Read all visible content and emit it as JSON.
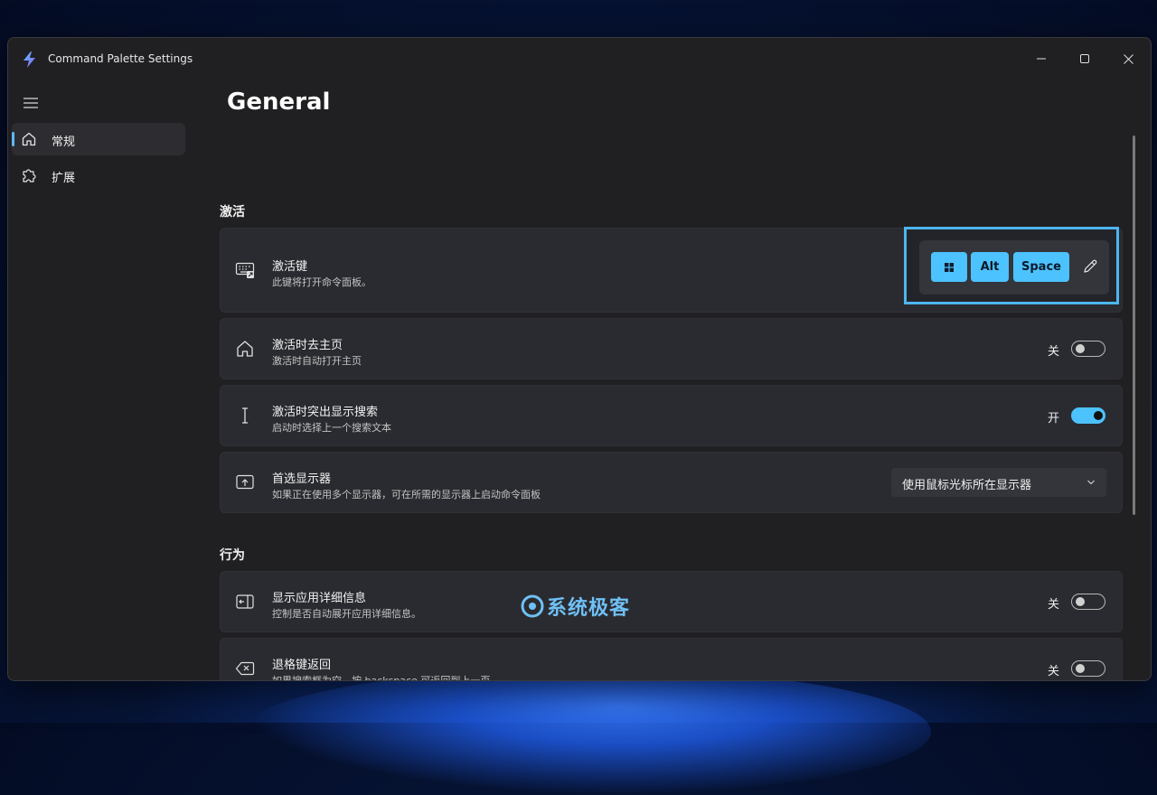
{
  "window": {
    "title": "Command Palette Settings",
    "accent": "#4cc2ff"
  },
  "sidebar": {
    "menu_icon": "hamburger-icon",
    "items": [
      {
        "label": "常规",
        "icon": "home-icon",
        "selected": true
      },
      {
        "label": "扩展",
        "icon": "puzzle-icon",
        "selected": false
      }
    ]
  },
  "page": {
    "title": "General",
    "sections": [
      {
        "header": "激活"
      },
      {
        "header": "行为"
      }
    ]
  },
  "settings": {
    "activation_key": {
      "title": "激活键",
      "desc": "此键将打开命令面板。",
      "keys": [
        "win-key-icon",
        "Alt",
        "Space"
      ],
      "edit_icon": "pencil-icon"
    },
    "go_home": {
      "title": "激活时去主页",
      "desc": "激活时自动打开主页",
      "state_label": "关",
      "on": false
    },
    "highlight_search": {
      "title": "激活时突出显示搜索",
      "desc": "启动时选择上一个搜索文本",
      "state_label": "开",
      "on": true
    },
    "preferred_monitor": {
      "title": "首选显示器",
      "desc": "如果正在使用多个显示器，可在所需的显示器上启动命令面板",
      "selected": "使用鼠标光标所在显示器"
    },
    "show_app_details": {
      "title": "显示应用详细信息",
      "desc": "控制是否自动展开应用详细信息。",
      "state_label": "关",
      "on": false
    },
    "backspace_back": {
      "title": "退格键返回",
      "desc": "如果搜索框为空，按 backspace 可返回到上一页",
      "state_label": "关",
      "on": false
    }
  },
  "watermark": {
    "text": "系统极客"
  }
}
